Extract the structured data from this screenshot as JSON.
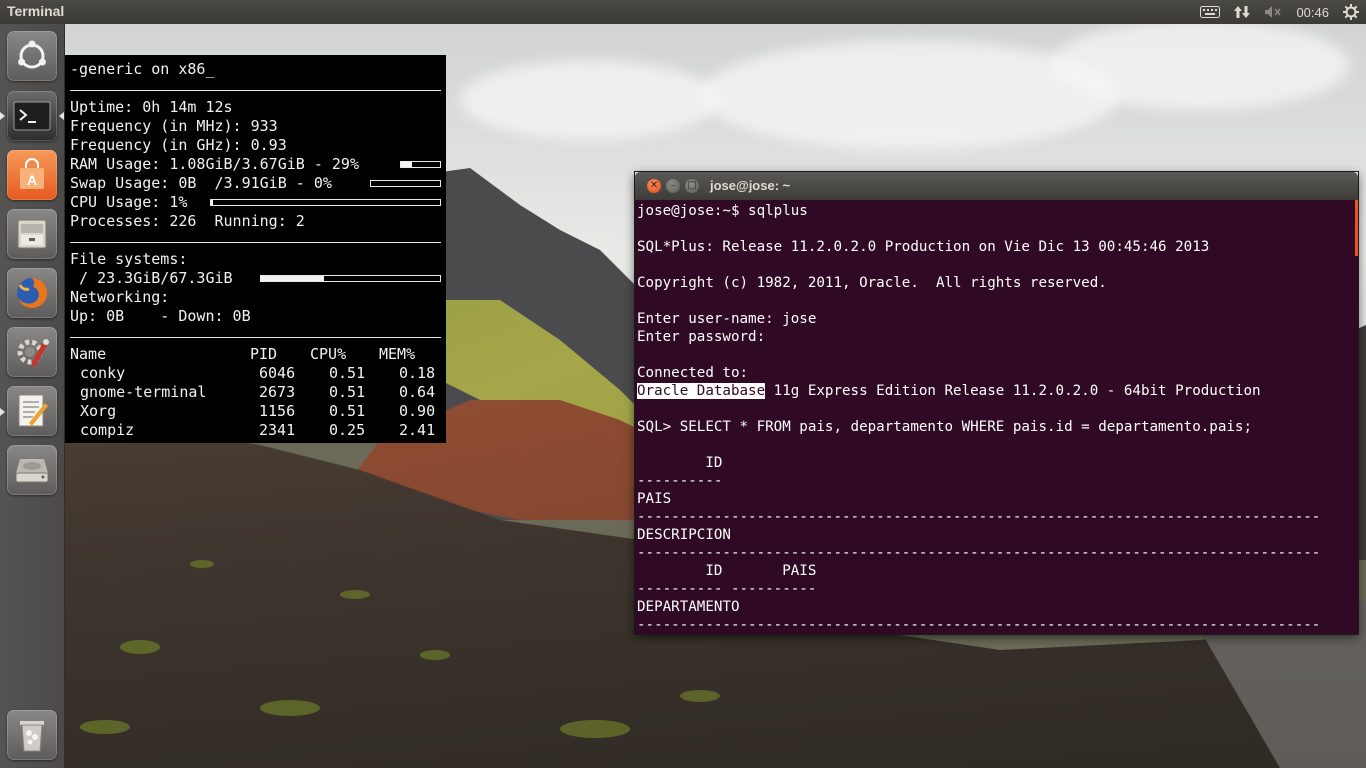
{
  "top_panel": {
    "app_title": "Terminal",
    "clock": "00:46",
    "icons": [
      "keyboard-icon",
      "network-updown-icon",
      "volume-muted-icon",
      "gear-icon"
    ]
  },
  "launcher": {
    "items": [
      "ubuntu-dash",
      "terminal",
      "software-center",
      "files",
      "firefox",
      "system-settings",
      "text-editor",
      "disk",
      "trash"
    ]
  },
  "conky": {
    "header": "-generic on x86_",
    "uptime_label": "Uptime: ",
    "uptime": "0h 14m 12s",
    "freq_mhz_label": "Frequency (in MHz): ",
    "freq_mhz": "933",
    "freq_ghz_label": "Frequency (in GHz): ",
    "freq_ghz": "0.93",
    "ram_label": "RAM Usage: ",
    "ram": "1.08GiB/3.67GiB",
    "ram_sep": " - ",
    "ram_pct": "29%",
    "ram_fraction": 0.29,
    "swap_label": "Swap Usage: ",
    "swap": "0B  /3.91GiB",
    "swap_sep": " - ",
    "swap_pct": "0%",
    "swap_fraction": 0.0,
    "cpu_label": "CPU Usage: ",
    "cpu_pct": "1%",
    "cpu_fraction": 0.01,
    "processes_label": "Processes: ",
    "processes": "226",
    "running_label": "Running: ",
    "running": "2",
    "fs_label": "File systems:",
    "fs_root": " / 23.3GiB/67.3GiB",
    "fs_fraction": 0.35,
    "net_label": "Networking:",
    "net_line": "Up: 0B    - Down: 0B",
    "proc_headers": [
      "Name",
      "PID",
      "CPU%",
      "MEM%"
    ],
    "processes_list": [
      {
        "name": "conky",
        "pid": "6046",
        "cpu": "0.51",
        "mem": "0.18"
      },
      {
        "name": "gnome-terminal",
        "pid": "2673",
        "cpu": "0.51",
        "mem": "0.64"
      },
      {
        "name": "Xorg",
        "pid": "1156",
        "cpu": "0.51",
        "mem": "0.90"
      },
      {
        "name": "compiz",
        "pid": "2341",
        "cpu": "0.25",
        "mem": "2.41"
      }
    ]
  },
  "terminal": {
    "title": "jose@jose: ~",
    "colors": {
      "background": "#300a24",
      "text": "#ffffff",
      "close": "#df4a16"
    },
    "lines": [
      "jose@jose:~$ sqlplus",
      "",
      "SQL*Plus: Release 11.2.0.2.0 Production on Vie Dic 13 00:45:46 2013",
      "",
      "Copyright (c) 1982, 2011, Oracle.  All rights reserved.",
      "",
      "Enter user-name: jose",
      "Enter password:",
      "",
      "Connected to:",
      "",
      "",
      "SQL> SELECT * FROM pais, departamento WHERE pais.id = departamento.pais;",
      "",
      "        ID",
      "----------",
      "PAIS",
      "--------------------------------------------------------------------------------",
      "DESCRIPCION",
      "--------------------------------------------------------------------------------",
      "        ID       PAIS",
      "---------- ----------",
      "DEPARTAMENTO",
      "--------------------------------------------------------------------------------"
    ],
    "highlight_text": "Oracle Database",
    "highlight_rest": " 11g Express Edition Release 11.2.0.2.0 - 64bit Production"
  }
}
